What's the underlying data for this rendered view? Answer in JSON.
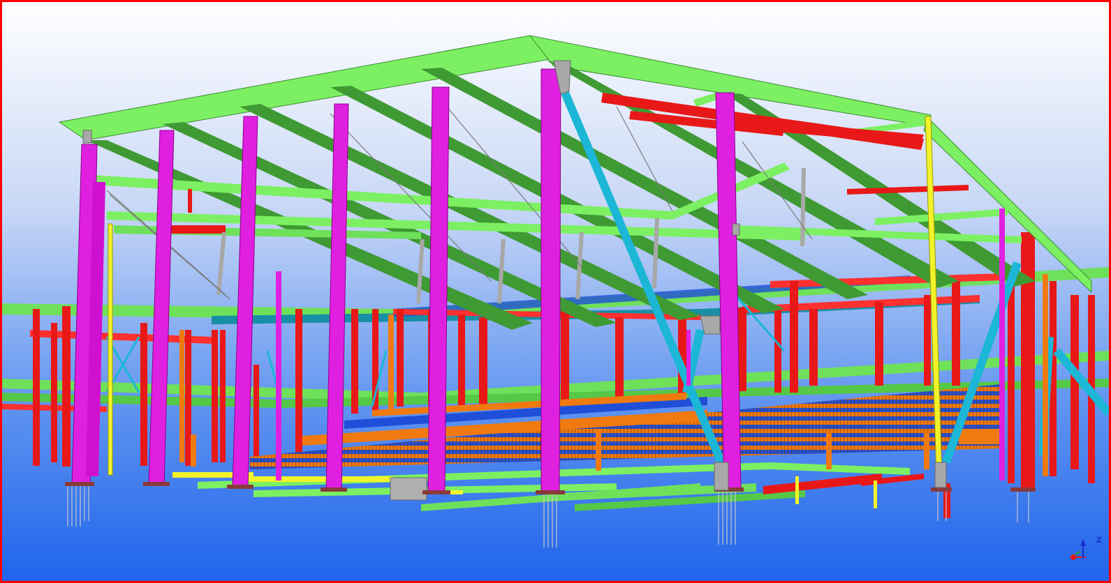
{
  "viewport": {
    "border_color": "#ff0000",
    "background_top": "#ffffff",
    "background_bottom": "#1f64ec"
  },
  "axis_indicator": {
    "z_label": "Z",
    "icon": "axis-triad-icon"
  },
  "colors": {
    "roof_beam_light": "#7cf062",
    "roof_beam_dark": "#3f9a33",
    "primary_column": "#e020e0",
    "secondary_column": "#e81818",
    "brace_cyan": "#1cb6d6",
    "yellow_member": "#f2f22a",
    "orange_member": "#f07a10",
    "deck_blue": "#1f4fd8",
    "deck_teal": "#178fa5",
    "gray_connection": "#a8a8a8"
  }
}
